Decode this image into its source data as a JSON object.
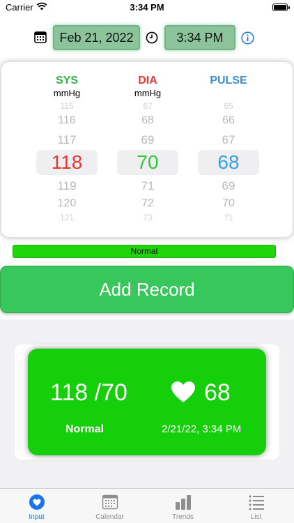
{
  "status_bar": {
    "carrier": "Carrier",
    "time": "3:34 PM"
  },
  "header": {
    "date": "Feb 21, 2022",
    "time": "3:34 PM"
  },
  "picker": {
    "columns": [
      {
        "title": "SYS",
        "unit": "mmHg",
        "color": "#2bb53e",
        "selected": "118",
        "selected_color": "#e53935",
        "above": [
          "115",
          "116",
          "117"
        ],
        "below": [
          "119",
          "120",
          "121"
        ]
      },
      {
        "title": "DIA",
        "unit": "mmHg",
        "color": "#e53935",
        "selected": "70",
        "selected_color": "#2ecc2e",
        "above": [
          "67",
          "68",
          "69"
        ],
        "below": [
          "71",
          "72",
          "73"
        ]
      },
      {
        "title": "PULSE",
        "unit": "",
        "color": "#3a8fd6",
        "selected": "68",
        "selected_color": "#3a9fe0",
        "above": [
          "65",
          "66",
          "67"
        ],
        "below": [
          "69",
          "70",
          "71"
        ]
      }
    ]
  },
  "status_strip": {
    "label": "Normal",
    "color": "#20d60a"
  },
  "add_button": {
    "label": "Add Record"
  },
  "summary": {
    "bp": "118 /70",
    "pulse": "68",
    "status": "Normal",
    "datetime": "2/21/22, 3:34 PM",
    "color": "#15cf0b"
  },
  "tabs": [
    {
      "label": "Input",
      "icon": "heart-icon",
      "active": true
    },
    {
      "label": "Calendar",
      "icon": "calendar-icon",
      "active": false
    },
    {
      "label": "Trends",
      "icon": "bar-chart-icon",
      "active": false
    },
    {
      "label": "List",
      "icon": "list-icon",
      "active": false
    }
  ]
}
